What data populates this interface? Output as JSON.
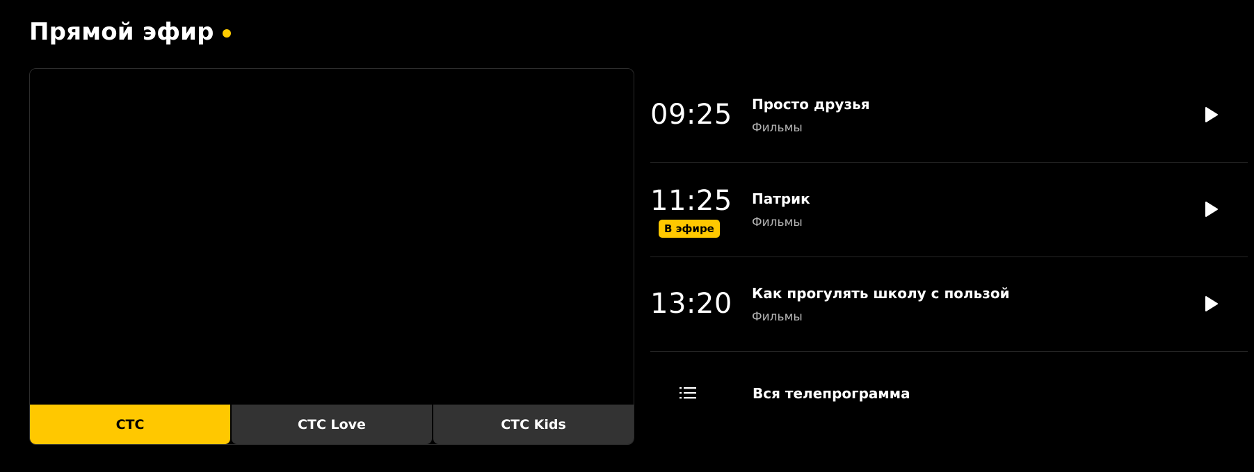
{
  "header": {
    "title": "Прямой эфир"
  },
  "colors": {
    "accent": "#ffc800",
    "background": "#000000",
    "tab_inactive": "#333333",
    "genre_text": "#b3b3b3"
  },
  "player": {
    "channels": [
      {
        "label": "СТС",
        "active": true
      },
      {
        "label": "СТС Love",
        "active": false
      },
      {
        "label": "СТС Kids",
        "active": false
      }
    ]
  },
  "schedule": {
    "items": [
      {
        "time": "09:25",
        "title": "Просто друзья",
        "genre": "Фильмы",
        "icon": "play-icon"
      },
      {
        "time": "11:25",
        "title": "Патрик",
        "genre": "Фильмы",
        "badge": "В эфире",
        "icon": "play-icon"
      },
      {
        "time": "13:20",
        "title": "Как прогулять школу с пользой",
        "genre": "Фильмы",
        "icon": "play-icon"
      }
    ],
    "all_programs_label": "Вся телепрограмма",
    "all_programs_icon": "list-icon"
  }
}
